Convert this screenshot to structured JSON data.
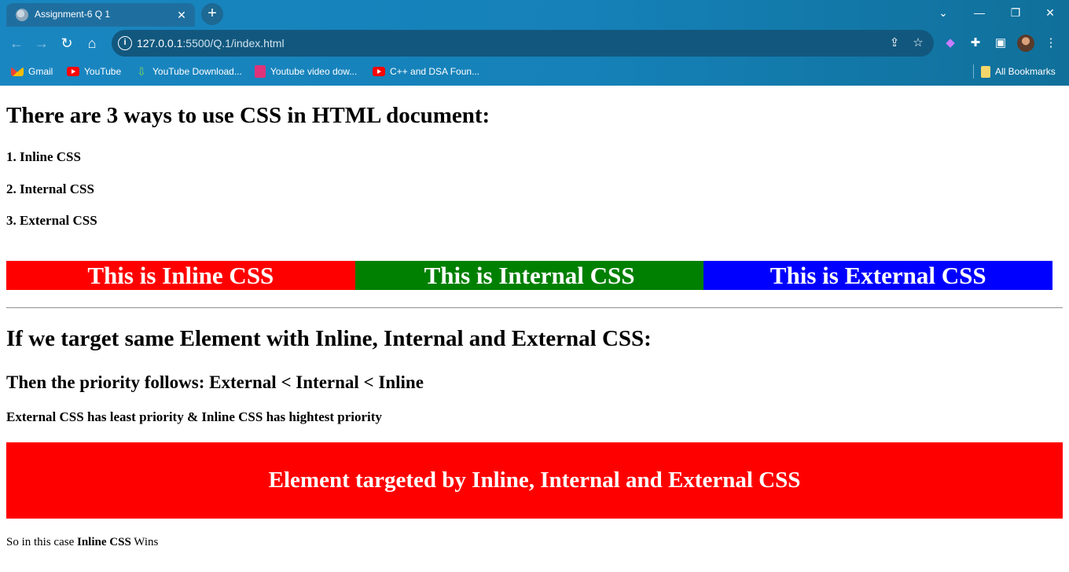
{
  "browser": {
    "tab_title": "Assignment-6 Q 1",
    "new_tab_label": "+",
    "url_host": "127.0.0.1",
    "url_path": ":5500/Q.1/index.html",
    "bookmarks": [
      {
        "label": "Gmail",
        "icon": "gmail-icon"
      },
      {
        "label": "YouTube",
        "icon": "youtube-icon"
      },
      {
        "label": "YouTube Download...",
        "icon": "download-icon"
      },
      {
        "label": "Youtube video dow...",
        "icon": "video-downloader-icon"
      },
      {
        "label": "C++ and DSA Foun...",
        "icon": "youtube-icon"
      }
    ],
    "all_bookmarks_label": "All Bookmarks"
  },
  "page": {
    "heading": "There are 3 ways to use CSS in HTML document:",
    "ways": [
      "1. Inline CSS",
      "2. Internal CSS",
      "3. External CSS"
    ],
    "boxes": {
      "inline": "This is Inline CSS",
      "internal": "This is Internal CSS",
      "external": "This is External CSS"
    },
    "target_heading": "If we target same Element with Inline, Internal and External CSS:",
    "priority_heading": "Then the priority follows: External < Internal < Inline",
    "least_text": "External CSS has least priority & Inline CSS has hightest priority",
    "target_box": "Element targeted by Inline, Internal and External CSS",
    "conclusion_prefix": "So in this case ",
    "conclusion_bold": "Inline CSS",
    "conclusion_suffix": " Wins"
  },
  "colors": {
    "inline": "#ff0000",
    "internal": "#008000",
    "external": "#0000ff",
    "chrome": "#1581b8"
  }
}
